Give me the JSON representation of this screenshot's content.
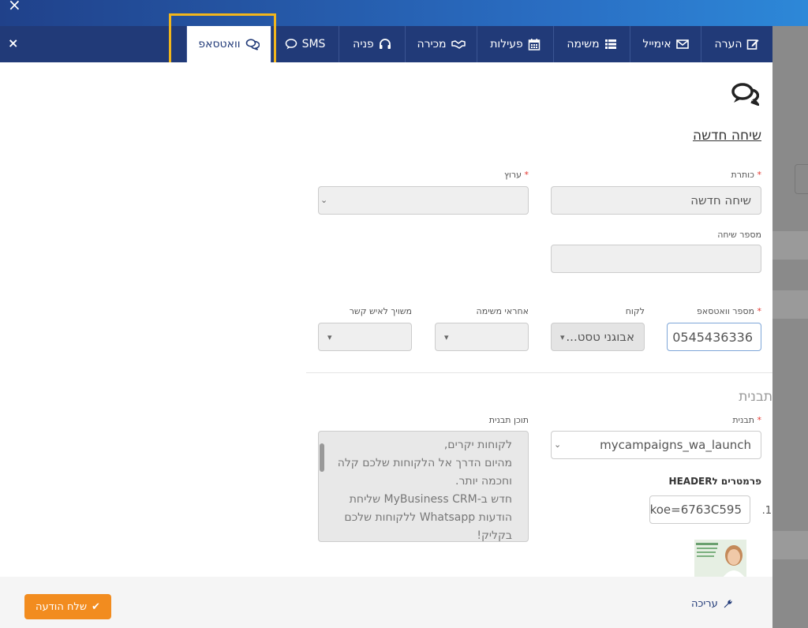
{
  "window": {
    "close_symbol": "×"
  },
  "tabs": [
    {
      "label": "הערה",
      "icon": "edit-note-icon"
    },
    {
      "label": "אימייל",
      "icon": "envelope-icon"
    },
    {
      "label": "משימה",
      "icon": "list-icon"
    },
    {
      "label": "פעילות",
      "icon": "calendar-icon"
    },
    {
      "label": "מכירה",
      "icon": "handshake-icon"
    },
    {
      "label": "פניה",
      "icon": "headset-icon"
    },
    {
      "label": "SMS",
      "icon": "speech-bubble-icon"
    },
    {
      "label": "וואטסאפ",
      "icon": "chat-bubbles-icon",
      "active": true
    }
  ],
  "close_label": "×",
  "form": {
    "section_title": "שיחה חדשה",
    "title_label": "כותרת",
    "title_value": "שיחה חדשה",
    "channel_label": "ערוץ",
    "conversation_number_label": "מספר שיחה",
    "conversation_number_value": "",
    "whatsapp_number_label": "מספר וואטסאפ",
    "whatsapp_number_value": "0545436336",
    "customer_label": "לקוח",
    "customer_value": "אבוגני טסט...",
    "task_owner_label": "אחראי משימה",
    "contact_label": "משויך לאיש קשר",
    "required_mark": "*"
  },
  "template": {
    "section_title": "תבנית",
    "template_label": "תבנית",
    "template_value": "mycampaigns_wa_launch",
    "content_label": "תוכן תבנית",
    "content_lines": [
      "לקוחות יקרים,",
      "מהיום הדרך אל הלקוחות שלכם קלה",
      "וחכמה יותר.",
      "חדש ב-MyBusiness CRM שליחת",
      "הודעות Whatsapp ללקוחות שלכם",
      "בקליק!"
    ],
    "header_params_label": "פרמטרים לHEADER",
    "param_index": "1.",
    "param_value": "koe=6763C595"
  },
  "footer": {
    "send_label": "שלח הודעה",
    "edit_label": "עריכה"
  },
  "colors": {
    "nav": "#213a78",
    "accent": "#f28c1f",
    "highlight": "#f2b61c",
    "required": "#e4362f"
  }
}
